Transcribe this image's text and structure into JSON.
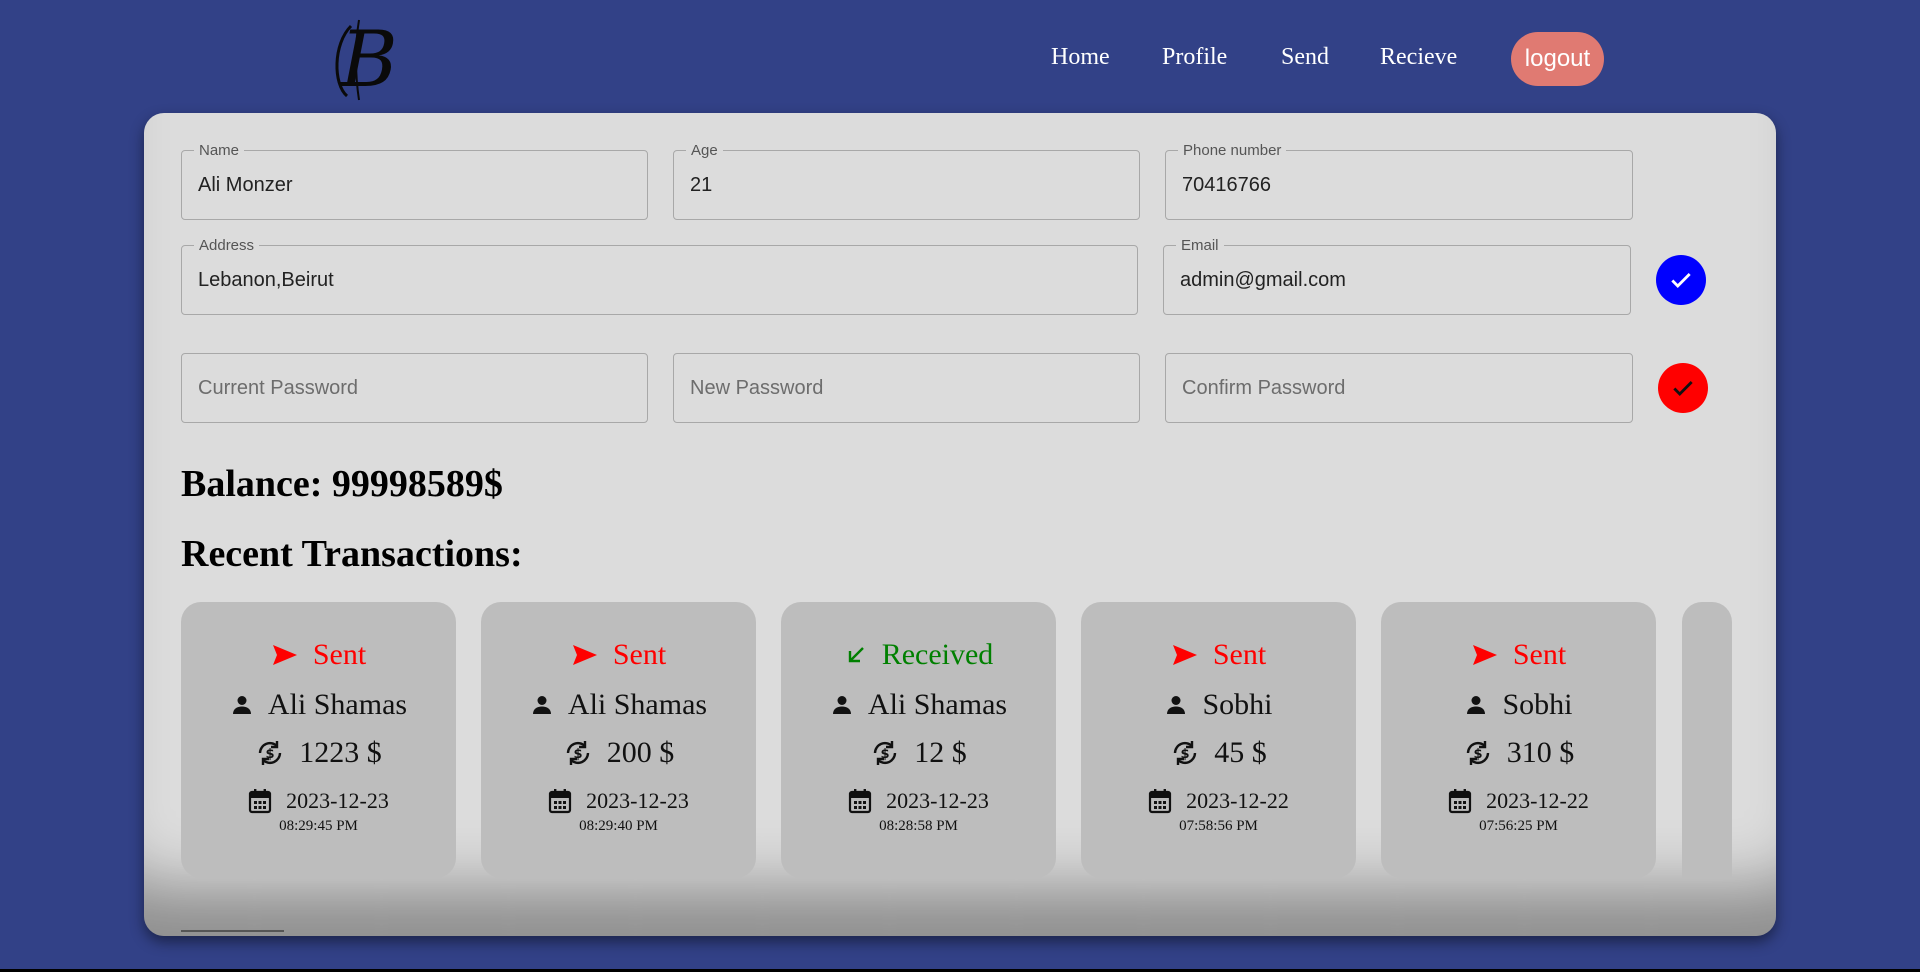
{
  "nav": {
    "items": [
      "Home",
      "Profile",
      "Send",
      "Recieve"
    ],
    "logout_label": "logout"
  },
  "profile": {
    "name": {
      "label": "Name",
      "value": "Ali Monzer"
    },
    "age": {
      "label": "Age",
      "value": "21"
    },
    "phone": {
      "label": "Phone number",
      "value": "70416766"
    },
    "address": {
      "label": "Address",
      "value": "Lebanon,Beirut"
    },
    "email": {
      "label": "Email",
      "value": "admin@gmail.com"
    }
  },
  "password": {
    "current_placeholder": "Current Password",
    "new_placeholder": "New Password",
    "confirm_placeholder": "Confirm Password"
  },
  "balance_text": "Balance: 99998589$",
  "recent_title": "Recent Transactions:",
  "transactions": [
    {
      "type": "Sent",
      "name": "Ali Shamas",
      "amount": "1223 $",
      "date": "2023-12-23",
      "time": "08:29:45 PM"
    },
    {
      "type": "Sent",
      "name": "Ali Shamas",
      "amount": "200 $",
      "date": "2023-12-23",
      "time": "08:29:40 PM"
    },
    {
      "type": "Received",
      "name": "Ali Shamas",
      "amount": "12 $",
      "date": "2023-12-23",
      "time": "08:28:58 PM"
    },
    {
      "type": "Sent",
      "name": "Sobhi",
      "amount": "45 $",
      "date": "2023-12-22",
      "time": "07:58:56 PM"
    },
    {
      "type": "Sent",
      "name": "Sobhi",
      "amount": "310 $",
      "date": "2023-12-22",
      "time": "07:56:25 PM"
    }
  ],
  "colors": {
    "background": "#324187",
    "logout": "#e07a72",
    "save_profile": "#0000ff",
    "save_password": "#ff0000",
    "sent": "#ff0000",
    "received": "#008000"
  },
  "icons": {
    "logo": "b-monogram-logo",
    "save_profile": "check-icon",
    "save_password": "check-icon",
    "sent": "send-icon",
    "received": "arrow-down-left-icon",
    "name": "person-icon",
    "amount": "currency-exchange-icon",
    "date": "calendar-icon"
  }
}
